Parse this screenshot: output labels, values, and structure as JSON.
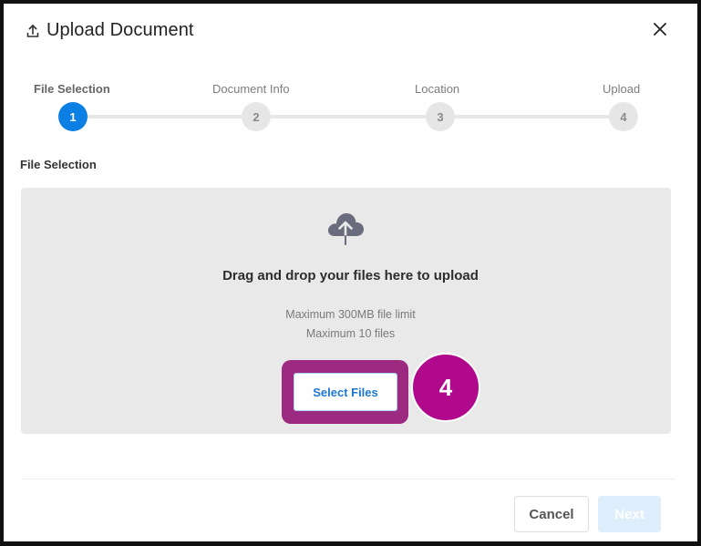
{
  "dialog": {
    "title": "Upload Document",
    "title_icon": "upload-icon",
    "close_icon": "close-icon"
  },
  "stepper": {
    "current_step": 1,
    "steps": [
      {
        "number": "1",
        "label": "File Selection",
        "state": "active"
      },
      {
        "number": "2",
        "label": "Document Info",
        "state": "inactive"
      },
      {
        "number": "3",
        "label": "Location",
        "state": "inactive"
      },
      {
        "number": "4",
        "label": "Upload",
        "state": "inactive"
      }
    ]
  },
  "section": {
    "label": "File Selection"
  },
  "dropzone": {
    "icon": "cloud-upload-icon",
    "title": "Drag and drop your files here to upload",
    "limit_size": "Maximum 300MB file limit",
    "limit_count": "Maximum 10 files",
    "select_button": "Select Files"
  },
  "annotation": {
    "badge_number": "4",
    "highlight_color": "#9b2a80",
    "badge_color": "#b0098c"
  },
  "footer": {
    "cancel_label": "Cancel",
    "next_label": "Next",
    "next_enabled": false
  },
  "colors": {
    "accent": "#0b7fe3",
    "link": "#1e77d3",
    "dropzone_bg": "#e9e9e9"
  }
}
